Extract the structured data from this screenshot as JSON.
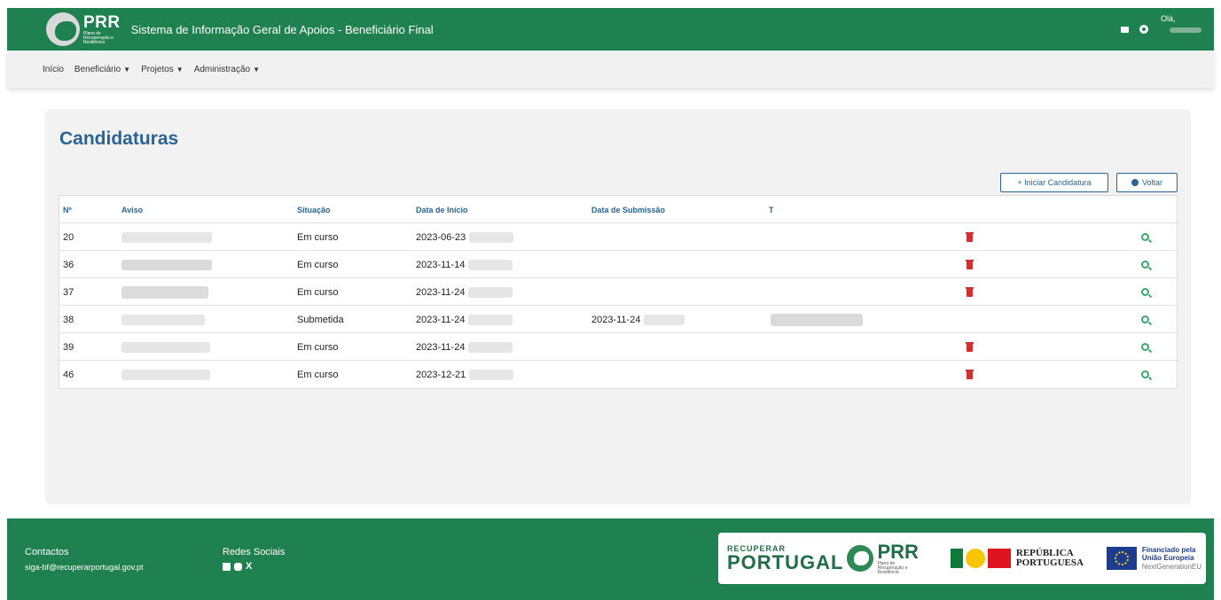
{
  "header": {
    "logo_text": "PRR",
    "logo_sub": "Plano de Recuperação e Resiliência",
    "app_title": "Sistema de Informação Geral de Apoios - Beneficiário Final",
    "greeting": "Olá,"
  },
  "nav": {
    "items": [
      {
        "label": "Início",
        "dropdown": false
      },
      {
        "label": "Beneficiário",
        "dropdown": true
      },
      {
        "label": "Projetos",
        "dropdown": true
      },
      {
        "label": "Administração",
        "dropdown": true
      }
    ],
    "caret": "▼"
  },
  "main": {
    "title": "Candidaturas",
    "new_button": "+ Iniciar Candidatura",
    "back_button": "Voltar",
    "columns": [
      "Nº",
      "Aviso",
      "Situação",
      "Data de Início",
      "Data de Submissão",
      "T"
    ],
    "rows": [
      {
        "num": "20",
        "situacao": "Em curso",
        "inicio": "2023-06-23",
        "submissao": "",
        "deletable": true
      },
      {
        "num": "36",
        "situacao": "Em curso",
        "inicio": "2023-11-14",
        "submissao": "",
        "deletable": true
      },
      {
        "num": "37",
        "situacao": "Em curso",
        "inicio": "2023-11-24",
        "submissao": "",
        "deletable": true
      },
      {
        "num": "38",
        "situacao": "Submetida",
        "inicio": "2023-11-24",
        "submissao": "2023-11-24",
        "deletable": false
      },
      {
        "num": "39",
        "situacao": "Em curso",
        "inicio": "2023-11-24",
        "submissao": "",
        "deletable": true
      },
      {
        "num": "46",
        "situacao": "Em curso",
        "inicio": "2023-12-21",
        "submissao": "",
        "deletable": true
      }
    ]
  },
  "footer": {
    "contacts_title": "Contactos",
    "contacts_email": "siga-bf@recuperarportugal.gov.pt",
    "social_title": "Redes Sociais",
    "social_icons": [
      "linkedin-icon",
      "youtube-icon",
      "x-icon"
    ],
    "x_glyph": "X",
    "recuperar": "RECUPERAR",
    "portugal": "PORTUGAL",
    "prr": "PRR",
    "prr_sub": "Plano de Recuperação e Resiliência",
    "republica_1": "REPÚBLICA",
    "republica_2": "PORTUGUESA",
    "eu_1": "Financiado pela",
    "eu_2": "União Europeia",
    "eu_3": "NextGenerationEU"
  },
  "colors": {
    "brand_green": "#1f8050",
    "link_blue": "#2a6496",
    "delete_red": "#d03030",
    "view_green": "#3aa86a"
  }
}
